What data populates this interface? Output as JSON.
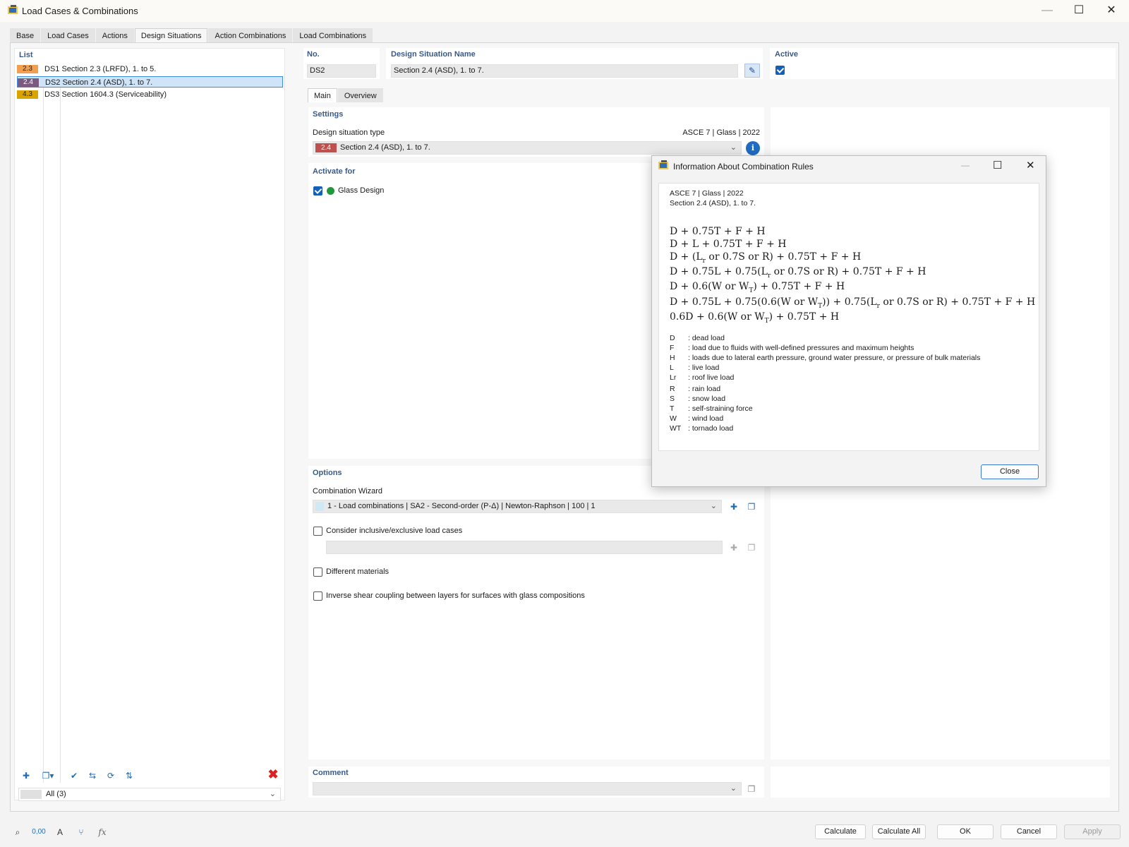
{
  "window": {
    "title": "Load Cases & Combinations"
  },
  "tabs": [
    "Base",
    "Load Cases",
    "Actions",
    "Design Situations",
    "Action Combinations",
    "Load Combinations"
  ],
  "active_tab": "Design Situations",
  "list": {
    "title": "List",
    "items": [
      {
        "badge": "2.3",
        "badge_color": "#f0a050",
        "label": "DS1  Section 2.3 (LRFD), 1. to 5."
      },
      {
        "badge": "2.4",
        "badge_color": "#7a5a80",
        "label": "DS2  Section 2.4 (ASD), 1. to 7."
      },
      {
        "badge": "4.3",
        "badge_color": "#d9a400",
        "label": "DS3  Section 1604.3 (Serviceability)"
      }
    ],
    "filter": "All (3)"
  },
  "header": {
    "no_label": "No.",
    "no_value": "DS2",
    "name_label": "Design Situation Name",
    "name_value": "Section 2.4 (ASD), 1. to 7.",
    "active_label": "Active"
  },
  "subtabs": [
    "Main",
    "Overview"
  ],
  "settings": {
    "title": "Settings",
    "type_label": "Design situation type",
    "standard": "ASCE 7 | Glass | 2022",
    "type_badge": "2.4",
    "type_badge_color": "#c0504d",
    "type_value": "Section 2.4 (ASD), 1. to 7."
  },
  "activate": {
    "title": "Activate for",
    "item": "Glass Design"
  },
  "options": {
    "title": "Options",
    "wizard_label": "Combination Wizard",
    "wizard_value": "1 - Load combinations | SA2 - Second-order (P-Δ) | Newton-Raphson | 100 | 1",
    "inclusive": "Consider inclusive/exclusive load cases",
    "materials": "Different materials",
    "shear": "Inverse shear coupling between layers for surfaces with glass compositions"
  },
  "comment": {
    "title": "Comment"
  },
  "bottom_buttons": {
    "calculate": "Calculate",
    "calculate_all": "Calculate All",
    "ok": "OK",
    "cancel": "Cancel",
    "apply": "Apply"
  },
  "dialog": {
    "title": "Information About Combination Rules",
    "line1": "ASCE 7 | Glass | 2022",
    "line2": "Section 2.4 (ASD), 1. to 7.",
    "close": "Close",
    "legend": [
      {
        "sym": "D",
        "desc": ": dead load"
      },
      {
        "sym": "F",
        "desc": ": load due to fluids with well-defined pressures and maximum heights"
      },
      {
        "sym": "H",
        "desc": ": loads due to lateral earth pressure, ground water pressure, or pressure of bulk materials"
      },
      {
        "sym": "L",
        "desc": ": live load"
      },
      {
        "sym": "Lr",
        "desc": ": roof live load"
      },
      {
        "sym": "R",
        "desc": ": rain load"
      },
      {
        "sym": "S",
        "desc": ": snow load"
      },
      {
        "sym": "T",
        "desc": ": self-straining force"
      },
      {
        "sym": "W",
        "desc": ": wind load"
      },
      {
        "sym": "WT",
        "desc": ": tornado load"
      }
    ]
  }
}
